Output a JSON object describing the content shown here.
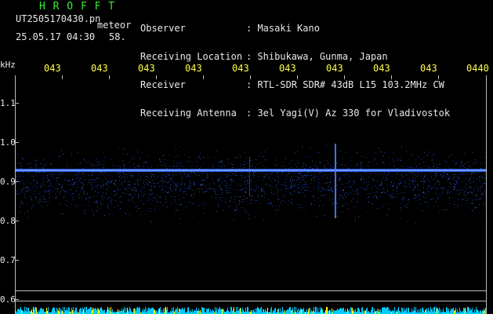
{
  "header": {
    "title": "H R O F F T",
    "filename": "UT2505170430.pn",
    "meteor_label": "meteor",
    "datetime": "25.05.17 04:30",
    "count": "58.",
    "info": [
      {
        "label": "Observer",
        "value": ": Masaki Kano"
      },
      {
        "label": "Receiving Location",
        "value": ": Shibukawa, Gunma, Japan"
      },
      {
        "label": "Receiver",
        "value": ": RTL-SDR SDR# 43dB L15 103.2MHz CW"
      },
      {
        "label": "Receiving Antenna",
        "value": ": 3el Yagi(V) Az 330 for Vladivostok"
      }
    ]
  },
  "axis": {
    "unit": "kHz",
    "x_ticks": [
      "043",
      "043",
      "043",
      "043",
      "043",
      "043",
      "043",
      "043",
      "043",
      "0440"
    ],
    "y_ticks": [
      "1.1",
      "1.0",
      "0.9",
      "0.8",
      "0.7",
      "0.6"
    ]
  },
  "colors": {
    "title": "#33ee33",
    "tick_labels": "#ffff44",
    "signal": "#3366ff",
    "activity_bars": "#00ccff",
    "activity_peaks": "#ffff00"
  }
}
